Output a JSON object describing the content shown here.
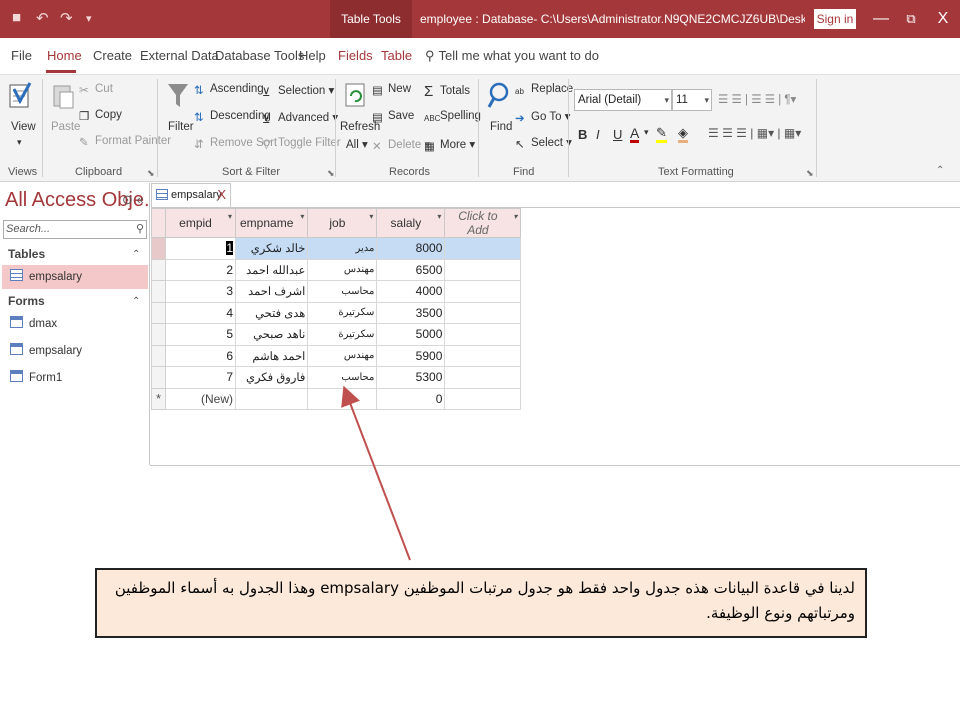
{
  "title_bar": {
    "context_group": "Table Tools",
    "document_title": "employee : Database- C:\\Users\\Administrator.N9QNE2CMCJZ6UB\\Desktop\\employee.accdb (Access ...",
    "sign_in": "Sign in",
    "minimize": "—",
    "restore": "⧉",
    "close": "X",
    "qa_save": "■",
    "qa_undo": "↶",
    "qa_redo": "↷",
    "qa_customize": "▾"
  },
  "ribbon_tabs": [
    "File",
    "Home",
    "Create",
    "External Data",
    "Database Tools",
    "Help",
    "Fields",
    "Table"
  ],
  "tell_me": "Tell me what you want to do",
  "ribbon": {
    "views": {
      "view": "View",
      "label": "Views"
    },
    "clipboard": {
      "paste": "Paste",
      "cut": "Cut",
      "copy": "Copy",
      "format_painter": "Format Painter",
      "label": "Clipboard"
    },
    "sort_filter": {
      "filter": "Filter",
      "ascending": "Ascending",
      "descending": "Descending",
      "remove_sort": "Remove Sort",
      "selection": "Selection",
      "advanced": "Advanced",
      "toggle_filter": "Toggle Filter",
      "label": "Sort & Filter"
    },
    "records": {
      "refresh": "Refresh",
      "all": "All",
      "new": "New",
      "save": "Save",
      "delete": "Delete",
      "totals": "Totals",
      "spelling": "Spelling",
      "more": "More",
      "label": "Records"
    },
    "find": {
      "find": "Find",
      "replace": "Replace",
      "goto": "Go To",
      "select": "Select",
      "label": "Find"
    },
    "text_formatting": {
      "font": "Arial (Detail)",
      "size": "11",
      "bold": "B",
      "italic": "I",
      "underline": "U",
      "label": "Text Formatting"
    }
  },
  "nav_pane": {
    "title": "All Access Obje...",
    "search_placeholder": "Search...",
    "sections": [
      {
        "name": "Tables",
        "items": [
          "empsalary"
        ]
      },
      {
        "name": "Forms",
        "items": [
          "dmax",
          "empsalary",
          "Form1"
        ]
      }
    ]
  },
  "document_tab": {
    "name": "empsalary",
    "close": "X"
  },
  "datasheet": {
    "columns": [
      "empid",
      "empname",
      "job",
      "salaly",
      "Click to Add"
    ],
    "rows": [
      {
        "empid": "1",
        "empname": "خالد شكري",
        "job": "مدير",
        "salaly": "8000"
      },
      {
        "empid": "2",
        "empname": "عبدالله احمد",
        "job": "مهندس",
        "salaly": "6500"
      },
      {
        "empid": "3",
        "empname": "اشرف احمد",
        "job": "محاسب",
        "salaly": "4000"
      },
      {
        "empid": "4",
        "empname": "هدى فتحي",
        "job": "سكرتيرة",
        "salaly": "3500"
      },
      {
        "empid": "5",
        "empname": "ناهد صبحي",
        "job": "سكرتيرة",
        "salaly": "5000"
      },
      {
        "empid": "6",
        "empname": "احمد هاشم",
        "job": "مهندس",
        "salaly": "5900"
      },
      {
        "empid": "7",
        "empname": "فاروق فكري",
        "job": "محاسب",
        "salaly": "5300"
      }
    ],
    "new_row": {
      "selector": "*",
      "empid": "(New)",
      "salaly": "0"
    }
  },
  "annotation": {
    "text": "لدينا في قاعدة البيانات هذه جدول واحد فقط هو جدول مرتبات الموظفين empsalary وهذا الجدول به أسماء الموظفين ومرتباتهم ونوع الوظيفة."
  },
  "colors": {
    "accent": "#a4373a",
    "selected_row": "#c6dcf5",
    "callout_bg": "#fde9d9",
    "arrow": "#c0504d"
  }
}
